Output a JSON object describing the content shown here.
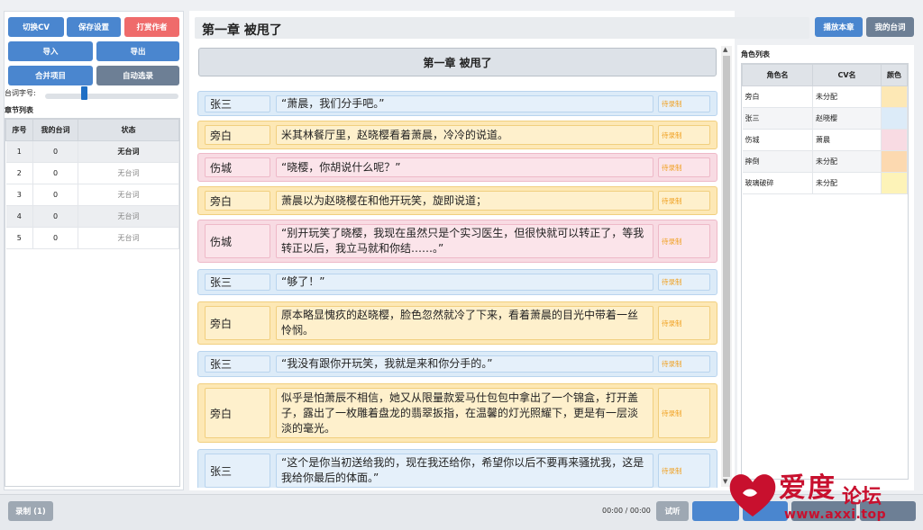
{
  "left": {
    "buttons": {
      "switch_cv": "切换CV",
      "save_settings": "保存设置",
      "tip_author": "打赏作者",
      "import": "导入",
      "export": "导出",
      "merge_project": "合并项目",
      "auto_select": "自动选录"
    },
    "font_size_label": "台词字号:",
    "font_size_level": 0.3,
    "chapter_list_title": "章节列表",
    "chapter_table": {
      "headers": [
        "序号",
        "我的台词",
        "状态"
      ],
      "rows": [
        {
          "no": "1",
          "mine": "0",
          "status": "无台词"
        },
        {
          "no": "2",
          "mine": "0",
          "status": "无台词"
        },
        {
          "no": "3",
          "mine": "0",
          "status": "无台词"
        },
        {
          "no": "4",
          "mine": "0",
          "status": "无台词"
        },
        {
          "no": "5",
          "mine": "0",
          "status": "无台词"
        }
      ]
    }
  },
  "main": {
    "chapter_title": "第一章 被甩了",
    "play_chapter": "播放本章",
    "my_lines": "我的台词",
    "banner": "第一章 被甩了",
    "lines": [
      {
        "role": "张三",
        "text": "“萧晨，我们分手吧。”",
        "status": "待录制",
        "color": "blue"
      },
      {
        "role": "旁白",
        "text": "米其林餐厅里，赵晓樱看着萧晨，冷冷的说道。",
        "status": "待录制",
        "color": "yellow"
      },
      {
        "role": "伤城",
        "text": "“晓樱，你胡说什么呢？”",
        "status": "待录制",
        "color": "pink"
      },
      {
        "role": "旁白",
        "text": "萧晨以为赵晓樱在和他开玩笑，旋即说道；",
        "status": "待录制",
        "color": "yellow"
      },
      {
        "role": "伤城",
        "text": "“别开玩笑了晓樱，我现在虽然只是个实习医生，但很快就可以转正了，等我转正以后，我立马就和你结……。”",
        "status": "待录制",
        "color": "pink"
      },
      {
        "role": "张三",
        "text": "“够了！”",
        "status": "待录制",
        "color": "blue"
      },
      {
        "role": "旁白",
        "text": "原本略显愧疚的赵晓樱，脸色忽然就冷了下来，看着萧晨的目光中带着一丝怜悯。",
        "status": "待录制",
        "color": "yellow"
      },
      {
        "role": "张三",
        "text": "“我没有跟你开玩笑，我就是来和你分手的。”",
        "status": "待录制",
        "color": "blue"
      },
      {
        "role": "旁白",
        "text": "似乎是怕萧辰不相信，她又从限量款爱马仕包包中拿出了一个锦盒，打开盖子，露出了一枚雕着盘龙的翡翠扳指，在温馨的灯光照耀下，更是有一层淡淡的毫光。",
        "status": "待录制",
        "color": "yellow"
      },
      {
        "role": "张三",
        "text": "“这个是你当初送给我的，现在我还给你，希望你以后不要再来骚扰我，这是我给你最后的体面。”",
        "status": "待录制",
        "color": "blue"
      }
    ]
  },
  "right": {
    "title": "角色列表",
    "headers": [
      "角色名",
      "CV名",
      "颜色"
    ],
    "roles": [
      {
        "name": "旁白",
        "cv": "未分配",
        "color": "#fde8b5"
      },
      {
        "name": "张三",
        "cv": "赵晓樱",
        "color": "#dcebf8"
      },
      {
        "name": "伤城",
        "cv": "萧晨",
        "color": "#f8dbe3"
      },
      {
        "name": "摔倒",
        "cv": "未分配",
        "color": "#fcd9b0"
      },
      {
        "name": "玻璃破碎",
        "cv": "未分配",
        "color": "#fdf3b8"
      }
    ]
  },
  "bottom": {
    "record": "录制 (1)",
    "time": "00:00 / 00:00",
    "audition": "试听"
  },
  "watermark": {
    "brand": "爱度",
    "suffix": "论坛",
    "url": "www.axxi.top"
  }
}
